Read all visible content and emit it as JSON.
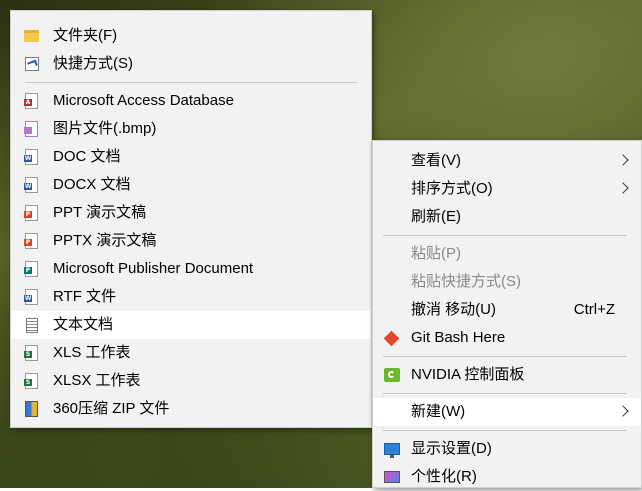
{
  "new_submenu": {
    "items": [
      {
        "label": "文件夹(F)",
        "icon": "folder-icon"
      },
      {
        "label": "快捷方式(S)",
        "icon": "shortcut-icon"
      },
      {
        "label": "Microsoft Access Database",
        "icon": "access-icon"
      },
      {
        "label": "图片文件(.bmp)",
        "icon": "bitmap-icon"
      },
      {
        "label": "DOC 文档",
        "icon": "doc-icon"
      },
      {
        "label": "DOCX 文档",
        "icon": "docx-icon"
      },
      {
        "label": "PPT 演示文稿",
        "icon": "ppt-icon"
      },
      {
        "label": "PPTX 演示文稿",
        "icon": "pptx-icon"
      },
      {
        "label": "Microsoft Publisher Document",
        "icon": "publisher-icon"
      },
      {
        "label": "RTF 文件",
        "icon": "rtf-icon"
      },
      {
        "label": "文本文档",
        "icon": "text-document-icon",
        "highlighted": true
      },
      {
        "label": "XLS 工作表",
        "icon": "xls-icon"
      },
      {
        "label": "XLSX 工作表",
        "icon": "xlsx-icon"
      },
      {
        "label": "360压缩 ZIP 文件",
        "icon": "zip-icon"
      }
    ]
  },
  "context_menu": {
    "items": [
      {
        "label": "查看(V)",
        "has_submenu": true
      },
      {
        "label": "排序方式(O)",
        "has_submenu": true
      },
      {
        "label": "刷新(E)"
      },
      {
        "label": "粘贴(P)",
        "disabled": true
      },
      {
        "label": "粘贴快捷方式(S)",
        "disabled": true
      },
      {
        "label": "撤消 移动(U)",
        "shortcut": "Ctrl+Z"
      },
      {
        "label": "Git Bash Here",
        "icon": "git-icon"
      },
      {
        "label": "NVIDIA 控制面板",
        "icon": "nvidia-icon"
      },
      {
        "label": "新建(W)",
        "has_submenu": true,
        "highlighted": true
      },
      {
        "label": "显示设置(D)",
        "icon": "display-settings-icon"
      },
      {
        "label": "个性化(R)",
        "icon": "personalize-icon"
      }
    ]
  },
  "colors": {
    "menu_background": "#f2f2f2",
    "highlight": "#ffffff",
    "disabled_text": "#8a8a8a",
    "word_blue": "#2b579a",
    "access_red": "#a4373a",
    "ppt_orange": "#d24726",
    "excel_green": "#217346",
    "publisher_teal": "#077568"
  }
}
